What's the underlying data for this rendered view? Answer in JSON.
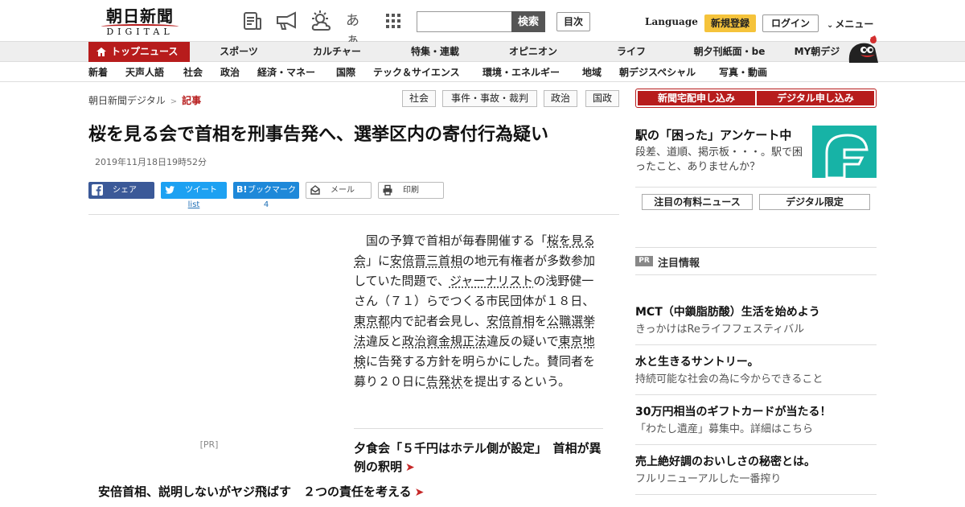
{
  "header": {
    "logo_main": "朝日新聞",
    "logo_sub": "DIGITAL",
    "font_size_glyph": "あぁ",
    "search_button": "検索",
    "search_placeholder": "",
    "toc_button": "目次",
    "language": "Language",
    "signup": "新規登録",
    "login": "ログイン",
    "menu": "メニュー"
  },
  "nav_main": {
    "active": "トップニュース",
    "items": [
      "スポーツ",
      "カルチャー",
      "特集・連載",
      "オピニオン",
      "ライフ",
      "朝夕刊紙面・be",
      "MY朝デジ"
    ]
  },
  "nav_sub": {
    "items": [
      "新着",
      "天声人語",
      "社会",
      "政治",
      "経済・マネー",
      "国際",
      "テック＆サイエンス",
      "環境・エネルギー",
      "地域",
      "朝デジスペシャル",
      "写真・動画"
    ]
  },
  "breadcrumb": {
    "home": "朝日新聞デジタル",
    "sep": ">",
    "current": "記事"
  },
  "tags": [
    "社会",
    "事件・事故・裁判",
    "政治",
    "国政"
  ],
  "article": {
    "headline": "桜を見る会で首相を刑事告発へ、選挙区内の寄付行為疑い",
    "date": "2019年11月18日19時52分",
    "share": {
      "facebook": "シェア",
      "twitter": "ツイート",
      "hatena": "ブックマーク",
      "mail": "メール",
      "print": "印刷"
    },
    "counts": {
      "twitter": "list",
      "hatena": "4"
    },
    "pr_label": "[PR]",
    "body": {
      "t1": "国の予算で首相が毎春開催する「",
      "l1": "桜を見る会",
      "t2": "」に",
      "l2": "安倍晋三首相",
      "t3": "の地元有権者が多数参加していた問題で、",
      "l3": "ジャーナリスト",
      "t4": "の浅野健一さん（７１）らでつくる市民団体が１８日、",
      "l4": "東京都",
      "t5": "内で記者会見し、",
      "l5": "安倍首相",
      "t6": "を",
      "l6": "公職選挙法",
      "t7": "違反と",
      "l7": "政治資金規正法",
      "t8": "違反の疑いで",
      "l8": "東京地検",
      "t9": "に告発する方針を明らかにした。賛同者を募り２０日に",
      "l9": "告発状",
      "t10": "を提出するという。"
    },
    "related": [
      "夕食会「５千円はホテル側が設定」　首相が異例の釈明",
      "安倍首相、説明しないがヤジ飛ばす　２つの責任を考える"
    ]
  },
  "sidebar": {
    "cta": [
      "新聞宅配申し込み",
      "デジタル申し込み"
    ],
    "survey": {
      "title": "駅の「困った」アンケート中",
      "desc": "段差、道順、掲示板・・・。駅で困ったこと、ありませんか？"
    },
    "buttons": [
      "注目の有料ニュース",
      "デジタル限定"
    ],
    "pr_badge": "PR",
    "pr_heading": "注目情報",
    "ads": [
      {
        "title": "MCT（中鎖脂肪酸）生活を始めよう",
        "sub": "きっかけはReライフフェスティバル"
      },
      {
        "title": "水と生きるサントリー。",
        "sub": "持続可能な社会の為に今からできること"
      },
      {
        "title": "30万円相当のギフトカードが当たる！",
        "sub": "「わたし遺産」募集中。詳細はこちら"
      },
      {
        "title": "売上絶好調のおいしさの秘密とは。",
        "sub": "フルリニューアルした一番搾り"
      }
    ]
  },
  "colors": {
    "brand_red": "#b71c1c",
    "signup_yellow": "#f5c33b",
    "facebook": "#3b5998",
    "twitter": "#1da1f2",
    "hatena": "#1e88d9",
    "survey_teal": "#17b3a6"
  },
  "icons": [
    "paper-icon",
    "megaphone-icon",
    "weather-icon",
    "font-size-icon",
    "grid-icon",
    "home-icon",
    "mascot-icon",
    "facebook-icon",
    "twitter-icon",
    "hatena-icon",
    "mail-icon",
    "print-icon",
    "arrow-right-icon"
  ]
}
